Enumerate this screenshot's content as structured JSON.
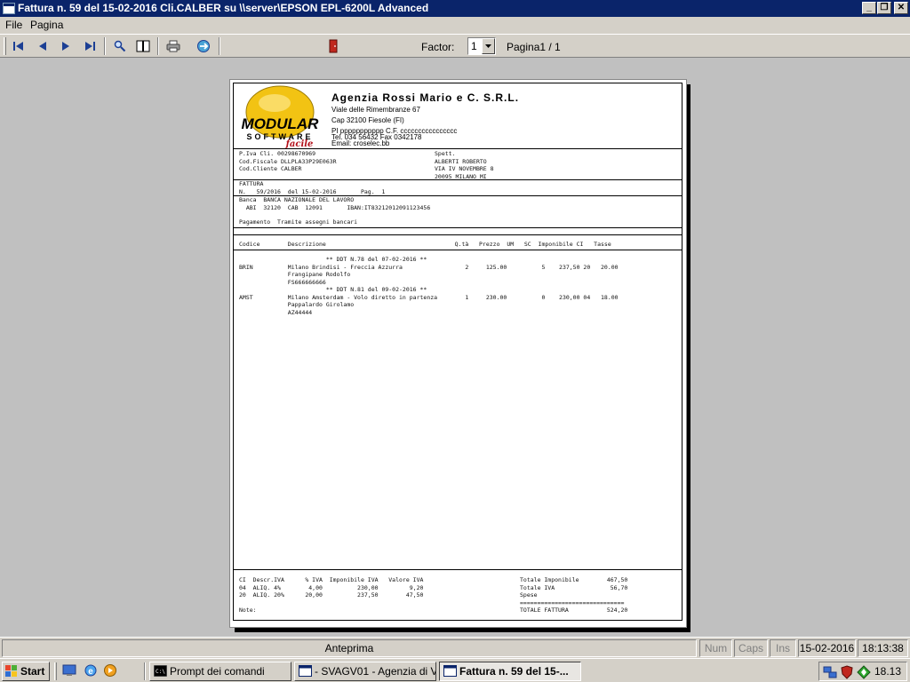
{
  "window": {
    "title": "Fattura n.   59 del 15-02-2016 Cli.CALBER su \\\\server\\EPSON EPL-6200L Advanced",
    "minimize": "_",
    "maximize": "❐",
    "close": "✕"
  },
  "menu": {
    "file": "File",
    "pagina": "Pagina"
  },
  "toolbar": {
    "factor_label": "Factor:",
    "factor_value": "1",
    "pagina_label": "Pagina1 / 1",
    "icons": [
      "first-page-icon",
      "prev-page-icon",
      "next-page-icon",
      "last-page-icon",
      "zoom-icon",
      "two-pages-icon",
      "print-icon",
      "export-icon",
      "exit-door-icon"
    ]
  },
  "document": {
    "company_name": "Agenzia Rossi Mario e C. S.R.L.",
    "logo_top": "MODULAR",
    "logo_mid": "SOFTWARE",
    "logo_script": "facile",
    "company_lines": [
      "Viale delle Rimembranze 67",
      "Cap 32100 Fiesole (FI)",
      "PI ppppppppppp  C.F. cccccccccccccccc",
      "Tel. 034 56432  Fax 0342178",
      "Email: croselec.bb"
    ],
    "customer_left": "P.Iva Cli. 00298670969\nCod.Fiscale DLLPLA33P29E063R\nCod.Cliente CALBER",
    "customer_right": "Spett.\nALBERTI ROBERTO\nVIA IV NOVEMBRE 8\n20095 MILANO MI",
    "invoice_block": "FATTURA\nN.   59/2016  del 15-02-2016       Pag.  1",
    "bank_block": "Banca  BANCA NAZIONALE DEL LAVORO\n  ABI  32120  CAB  12091       IBAN:IT83212012091123456",
    "payment": "Pagamento  Tramite assegni bancari",
    "headers": "Codice        Descrizione                                     Q.tà   Prezzo  UM   SC  Imponibile CI   Tasse",
    "rows": "                         ** DDT N.78 del 07-02-2016 **\nBRIN          Milano Brindisi - Freccia Azzurra                  2     125.00          5    237,50 20   20.00\n              Frangipane Rodolfo\n              FS666666666\n                         ** DDT N.81 del 09-02-2016 **\nAMST          Milano Amsterdam - Volo diretto in partenza        1     230.00          0    230,00 04   18.00\n              Pappalardo Girolamo\n              AZ44444",
    "footer_left": "CI  Descr.IVA      % IVA  Imponibile IVA   Valore IVA\n04  ALIQ. 4%        4,00          230,00         9,20\n20  ALIQ. 20%      20,00          237,50        47,50\n\nNote:",
    "footer_right": "Totale Imponibile        467,50\nTotale IVA                56,70\nSpese\n==============================\nTOTALE FATTURA           524,20"
  },
  "statusbar": {
    "left": "Anteprima",
    "num": "Num",
    "caps": "Caps",
    "ins": "Ins",
    "date": "15-02-2016",
    "time": "18:13:38"
  },
  "taskbar": {
    "start": "Start",
    "tasks": [
      "Prompt dei comandi",
      "- SVAGV01 - Agenzia di V...",
      "Fattura n.   59 del 15-..."
    ],
    "clock": "18.13"
  }
}
